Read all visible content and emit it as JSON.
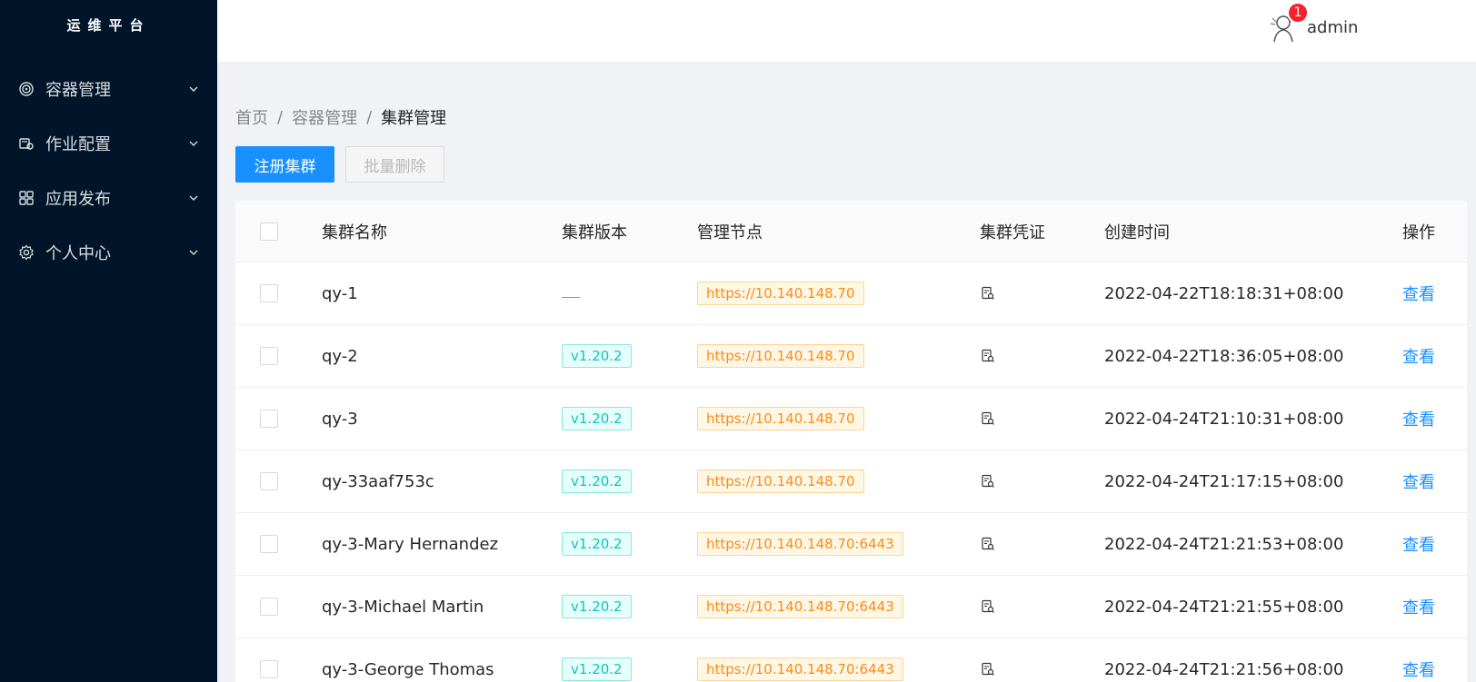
{
  "app": {
    "title": "运维平台"
  },
  "sidebar": {
    "items": [
      {
        "label": "容器管理",
        "icon": "container-icon"
      },
      {
        "label": "作业配置",
        "icon": "job-config-icon"
      },
      {
        "label": "应用发布",
        "icon": "app-grid-icon"
      },
      {
        "label": "个人中心",
        "icon": "settings-gear-icon"
      }
    ]
  },
  "header": {
    "username": "admin",
    "notification_count": "1"
  },
  "breadcrumb": {
    "items": [
      "首页",
      "容器管理"
    ],
    "current": "集群管理",
    "separator": "/"
  },
  "toolbar": {
    "register_label": "注册集群",
    "batch_delete_label": "批量删除"
  },
  "table": {
    "columns": {
      "name": "集群名称",
      "version": "集群版本",
      "node": "管理节点",
      "credential": "集群凭证",
      "created": "创建时间",
      "action": "操作"
    },
    "rows": [
      {
        "name": "qy-1",
        "version": "",
        "node": "https://10.140.148.70",
        "created": "2022-04-22T18:18:31+08:00",
        "action": "查看"
      },
      {
        "name": "qy-2",
        "version": "v1.20.2",
        "node": "https://10.140.148.70",
        "created": "2022-04-22T18:36:05+08:00",
        "action": "查看"
      },
      {
        "name": "qy-3",
        "version": "v1.20.2",
        "node": "https://10.140.148.70",
        "created": "2022-04-24T21:10:31+08:00",
        "action": "查看"
      },
      {
        "name": "qy-33aaf753c",
        "version": "v1.20.2",
        "node": "https://10.140.148.70",
        "created": "2022-04-24T21:17:15+08:00",
        "action": "查看"
      },
      {
        "name": "qy-3-Mary Hernandez",
        "version": "v1.20.2",
        "node": "https://10.140.148.70:6443",
        "created": "2022-04-24T21:21:53+08:00",
        "action": "查看"
      },
      {
        "name": "qy-3-Michael Martin",
        "version": "v1.20.2",
        "node": "https://10.140.148.70:6443",
        "created": "2022-04-24T21:21:55+08:00",
        "action": "查看"
      },
      {
        "name": "qy-3-George Thomas",
        "version": "v1.20.2",
        "node": "https://10.140.148.70:6443",
        "created": "2022-04-24T21:21:56+08:00",
        "action": "查看"
      }
    ]
  },
  "colors": {
    "sidebar_bg": "#001529",
    "primary": "#1890ff",
    "tag_cyan": "#13c2c2",
    "tag_orange": "#fa8c16",
    "badge": "#f5222d"
  }
}
